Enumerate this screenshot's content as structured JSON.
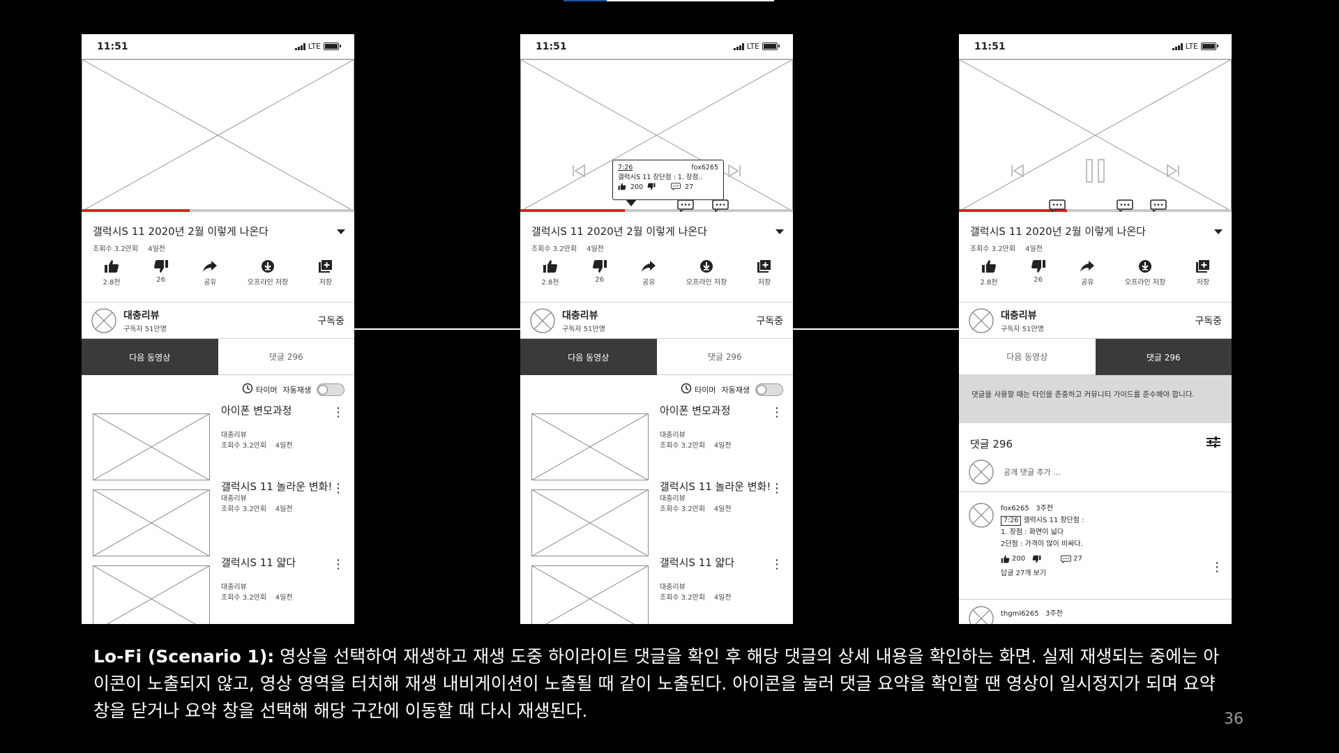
{
  "colors": {
    "background": "#000000",
    "panel": "#ffffff",
    "progress_red": "#e02020",
    "active_tab": "#3a3a3a",
    "notice_bg": "#d9d9d9",
    "caption_text": "#ffffff",
    "page_number": "#9a9a9a"
  },
  "phone_common": {
    "status_time": "11:51",
    "network": "LTE",
    "video_title": "갤럭시S 11 2020년 2월 이렇게 나온다",
    "views": "조회수 3.2만회",
    "age": "4일전",
    "actions": [
      {
        "icon": "thumbs-up-icon",
        "label": "2.8천"
      },
      {
        "icon": "thumbs-down-icon",
        "label": "26"
      },
      {
        "icon": "share-icon",
        "label": "공유"
      },
      {
        "icon": "download-icon",
        "label": "오프라인 저장"
      },
      {
        "icon": "save-playlist-icon",
        "label": "저장"
      }
    ],
    "channel_name": "대충리뷰",
    "channel_subs": "구독자 51만명",
    "subscribe_label": "구독중",
    "tab_next": "다음 동영상",
    "tab_comments": "댓글 296",
    "timer_label": "타이머",
    "autoplay_label": "자동재생",
    "up_next": [
      {
        "title": "아이폰 변모과정",
        "channel": "대충리뷰",
        "meta": "조회수 3.2만회    4일전"
      },
      {
        "title": "갤럭시S 11 놀라운 변화!",
        "channel": "대충리뷰",
        "meta": "조회수 3.2만회    4일전"
      },
      {
        "title": "갤럭시S 11 얇다",
        "channel": "대충리뷰",
        "meta": "조회수 3.2만회    4일전"
      }
    ]
  },
  "phones": [
    {
      "id": "phone-1",
      "progress_fraction": 0.4,
      "active_tab": "next"
    },
    {
      "id": "phone-2",
      "progress_fraction": 0.4,
      "active_tab": "next",
      "tooltip": {
        "time": "7:26",
        "user": "fox6265",
        "text": "갤럭시S 11 장단점 : 1. 장점..",
        "likes": "200",
        "replies": "27"
      }
    },
    {
      "id": "phone-3",
      "progress_fraction": 0.4,
      "active_tab": "comments",
      "notice": "댓글을 사용할 때는 타인을 존중하고 커뮤니티 가이드를 준수해야 합니다.",
      "comments_header": "댓글 296",
      "add_comment_placeholder": "공개 댓글 추가 ...",
      "comment": {
        "user": "fox6265",
        "age": "3주전",
        "timestamp": "7:26",
        "first_line": "갤럭시S 11 장단점 :",
        "line2": "1. 장점 : 화면이 넓다",
        "line3": "2단점 : 가격이 많이 비싸다.",
        "likes": "200",
        "replies": "27",
        "view_replies": "답글 27개 보기"
      },
      "comment2": {
        "user": "thgml6265",
        "age": "3주전"
      }
    }
  ],
  "caption": {
    "bold": "Lo-Fi (Scenario 1):",
    "text": " 영상을 선택하여 재생하고 재생 도중 하이라이트 댓글을 확인 후 해당 댓글의 상세 내용을 확인하는 화면. 실제 재생되는 중에는 아이콘이 노출되지 않고, 영상 영역을 터치해 재생 내비게이션이 노출될 때 같이 노출된다. 아이콘을 눌러 댓글 요약을 확인할 땐 영상이 일시정지가 되며 요약 창을 닫거나 요약 창을 선택해 해당 구간에 이동할 때 다시 재생된다."
  },
  "page_number": "36"
}
